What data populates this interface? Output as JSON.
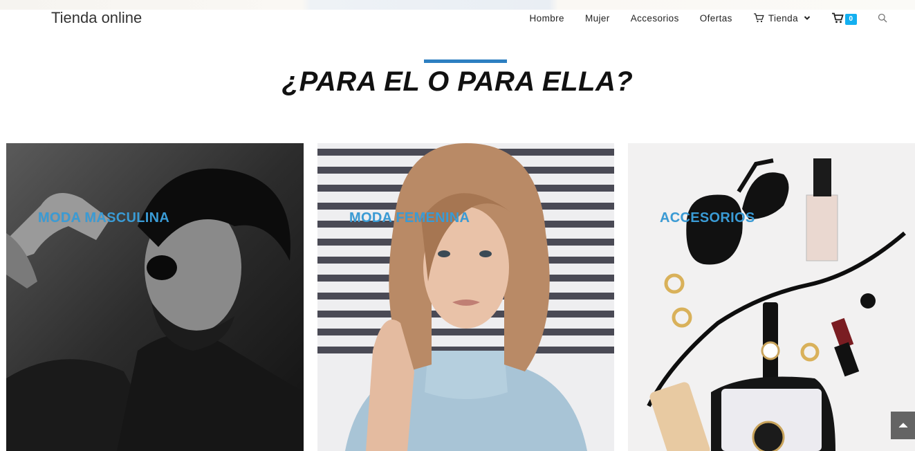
{
  "site": {
    "brand": "Tienda online"
  },
  "nav": {
    "items": [
      {
        "label": "Hombre"
      },
      {
        "label": "Mujer"
      },
      {
        "label": "Accesorios"
      },
      {
        "label": "Ofertas"
      },
      {
        "label": "Tienda"
      }
    ],
    "cart_count": "0"
  },
  "section": {
    "title": "¿PARA EL O PARA ELLA?"
  },
  "cards": [
    {
      "label": "MODA MASCULINA"
    },
    {
      "label": "MODA FEMENINA"
    },
    {
      "label": "ACCESORIOS"
    }
  ],
  "colors": {
    "accent": "#2d7fc1",
    "badge": "#13aff0",
    "label": "#3a9bd5"
  },
  "icons": [
    "cart-icon",
    "chevron-down-icon",
    "search-icon",
    "arrow-up-icon"
  ]
}
